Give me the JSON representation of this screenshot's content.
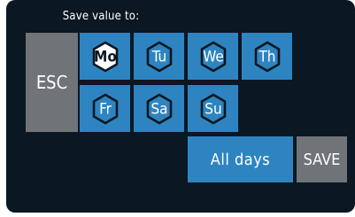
{
  "header": {
    "title": "Save value to:"
  },
  "buttons": {
    "esc": "ESC",
    "all_days": "All days",
    "save": "SAVE"
  },
  "days": [
    {
      "label": "Mo",
      "selected": true
    },
    {
      "label": "Tu",
      "selected": false
    },
    {
      "label": "We",
      "selected": false
    },
    {
      "label": "Th",
      "selected": false
    },
    {
      "label": "Fr",
      "selected": false
    },
    {
      "label": "Sa",
      "selected": false
    },
    {
      "label": "Su",
      "selected": false
    }
  ],
  "colors": {
    "background": "#0b1722",
    "accent_blue": "#2e84c0",
    "button_grey": "#707478",
    "text": "#ffffff"
  }
}
